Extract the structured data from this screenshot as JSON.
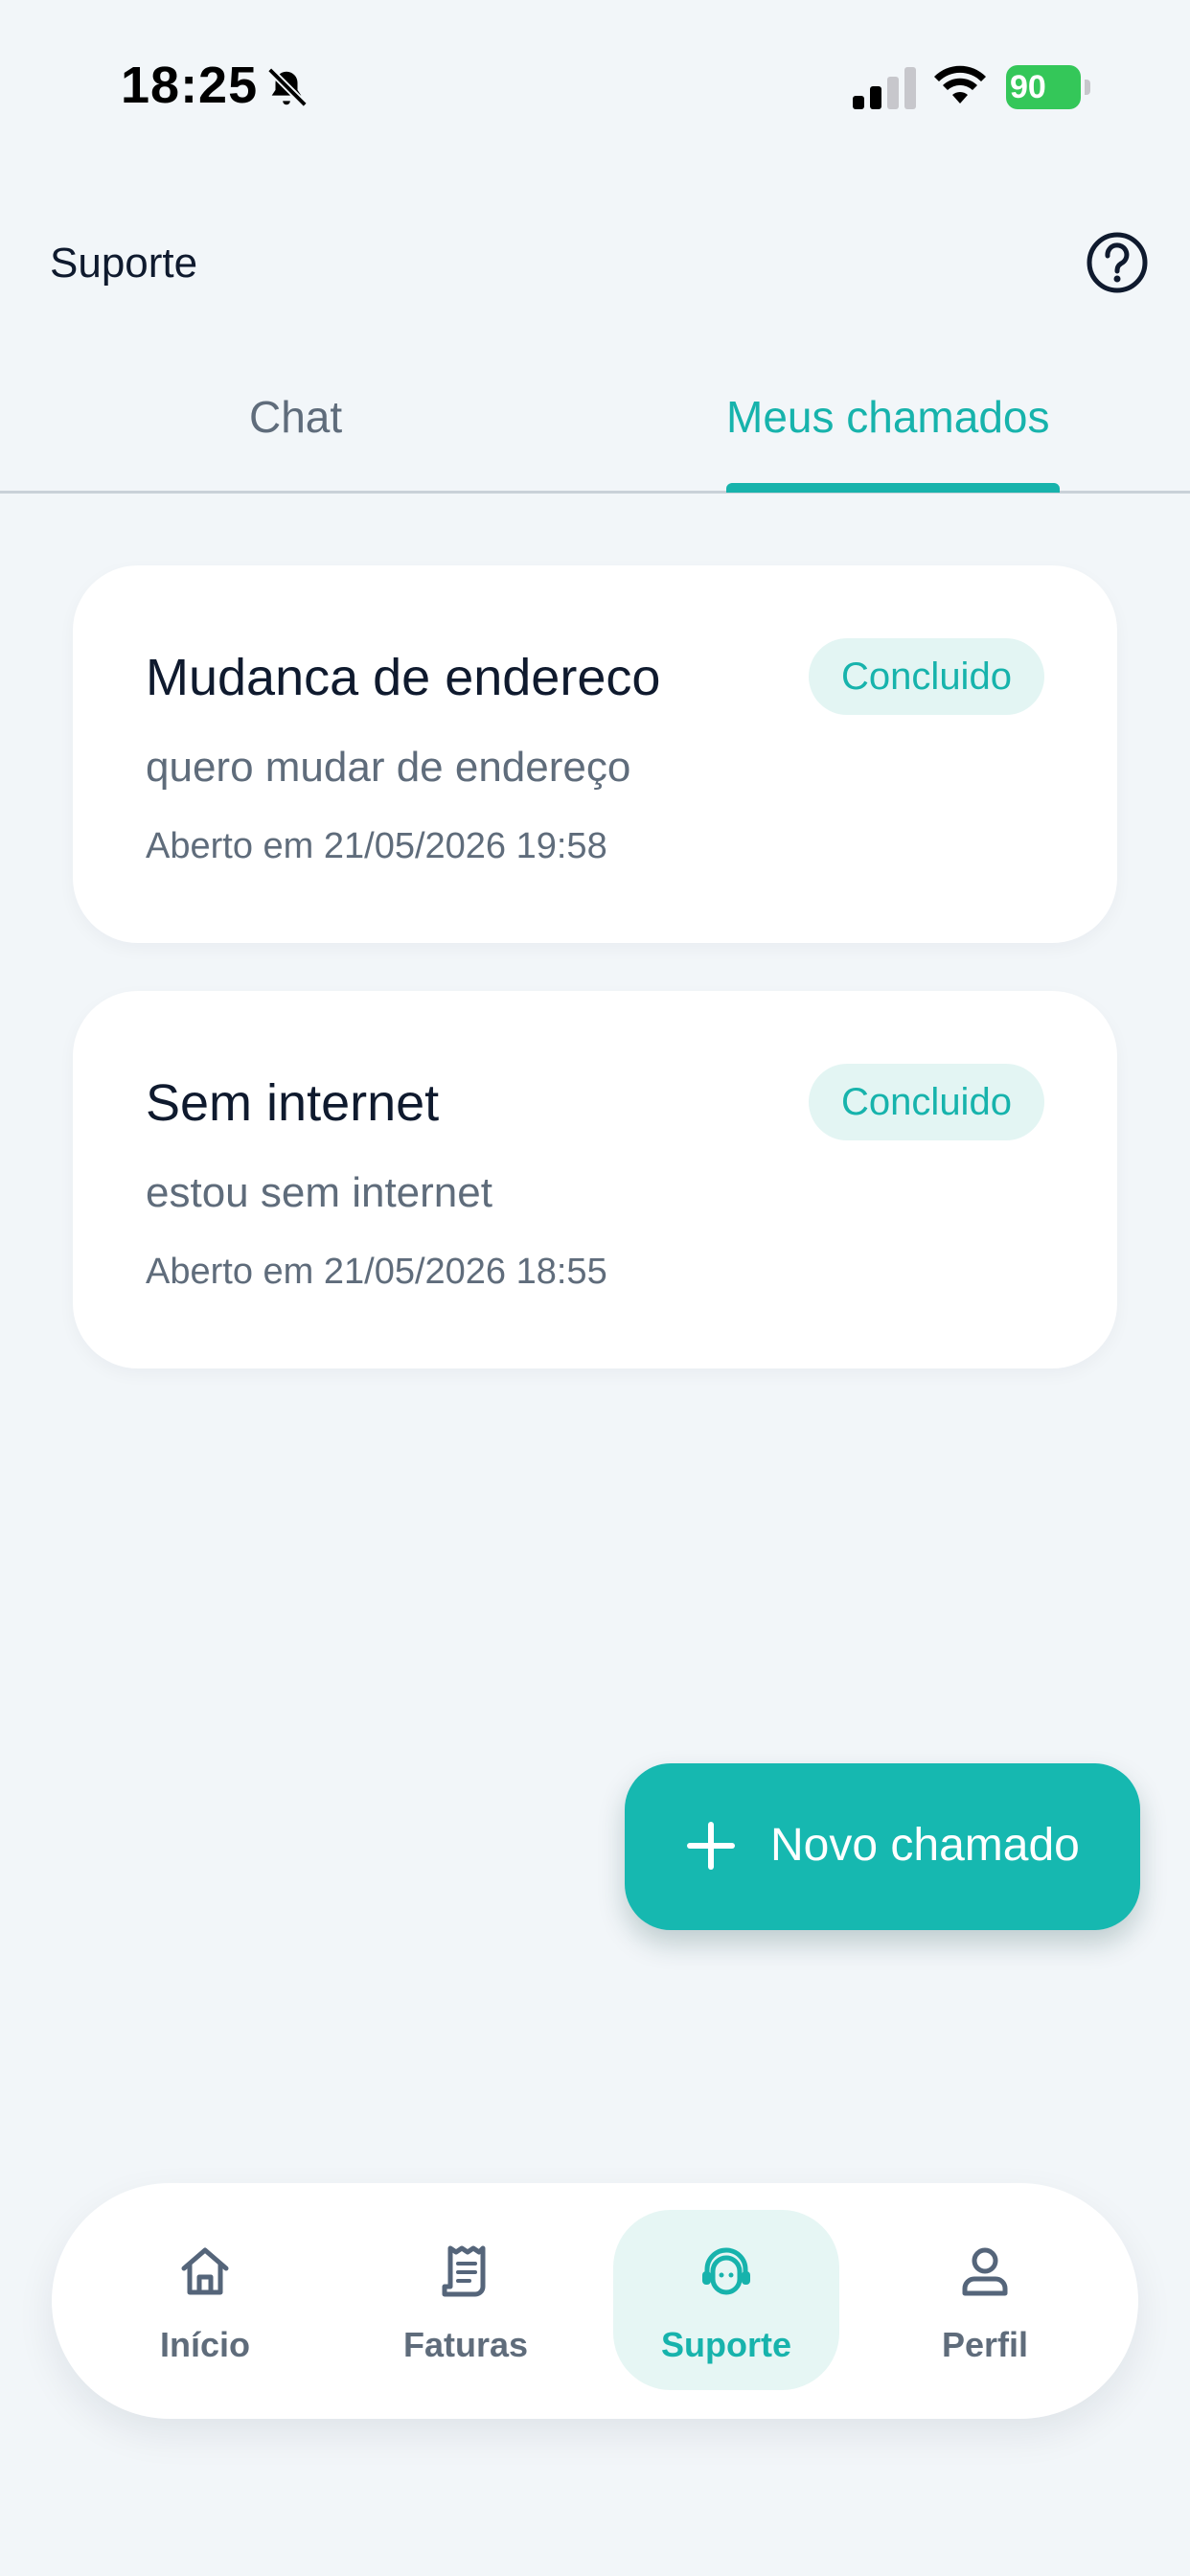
{
  "status_bar": {
    "time": "18:25",
    "battery_level": "90",
    "battery_color": "#34c759",
    "icons": [
      "bell-off-icon",
      "cellular-signal-icon",
      "wifi-icon",
      "battery-charging-icon"
    ]
  },
  "header": {
    "title": "Suporte",
    "help_icon": "question-circle-icon"
  },
  "tabs": [
    {
      "label": "Chat",
      "active": false
    },
    {
      "label": "Meus chamados",
      "active": true
    }
  ],
  "tickets": [
    {
      "title": "Mudanca de endereco",
      "description": "quero mudar de endereço",
      "opened": "Aberto em 21/05/2026 19:58",
      "status": "Concluido"
    },
    {
      "title": "Sem internet",
      "description": "estou sem internet",
      "opened": "Aberto em 21/05/2026 18:55",
      "status": "Concluido"
    }
  ],
  "fab": {
    "label": "Novo chamado",
    "icon": "plus-icon"
  },
  "bottom_nav": [
    {
      "label": "Início",
      "icon": "home-icon",
      "active": false
    },
    {
      "label": "Faturas",
      "icon": "receipt-icon",
      "active": false
    },
    {
      "label": "Suporte",
      "icon": "headset-icon",
      "active": true
    },
    {
      "label": "Perfil",
      "icon": "user-icon",
      "active": false
    }
  ],
  "colors": {
    "accent": "#17b3ac",
    "fab": "#16b8b0",
    "text_primary": "#0f1a2e",
    "text_secondary": "#5f6c7b",
    "background": "#f2f6f9"
  }
}
